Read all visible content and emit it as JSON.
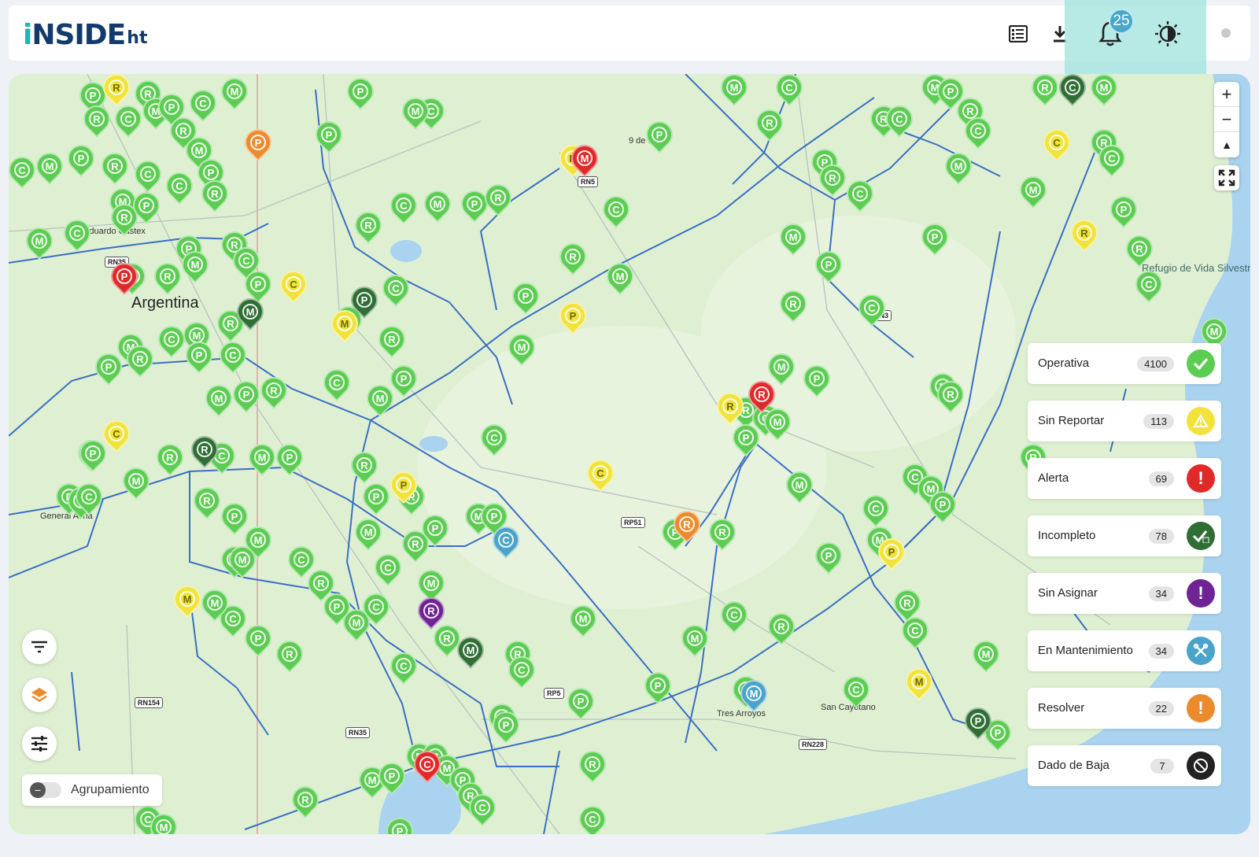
{
  "header": {
    "logo_main": "NSIDE",
    "logo_i": "i",
    "logo_sub": "ht",
    "notifications_count": "25",
    "icons": [
      "table-icon",
      "download-icon",
      "bell-icon",
      "contrast-icon"
    ]
  },
  "map": {
    "places": {
      "argentina": "Argentina",
      "eduardo_castex": "Eduardo Castex",
      "general_acha": "General Acha",
      "nueve_de_julio": "9 de Julio",
      "refugio": "Refugio de Vida Silvestre Bahía de Samborombón",
      "tres_arroyos": "Tres Arroyos",
      "san_cayetano": "San Cayetano"
    },
    "roads": [
      "RN35",
      "RN5",
      "RP51",
      "RN3",
      "RN154",
      "RN35",
      "RN228",
      "RP5"
    ],
    "marker_letters": [
      "P",
      "R",
      "C",
      "M"
    ],
    "colors": {
      "operativa": "#5ccc52",
      "sin_reportar": "#f2e33c",
      "alerta": "#e02a2a",
      "incompleto": "#2f6e34",
      "sin_asignar": "#6f2394",
      "mantenimiento": "#4aa3c8",
      "resolver": "#ec8b2d",
      "baja": "#222222"
    }
  },
  "controls": {
    "zoom_in": "+",
    "zoom_out": "−",
    "compass": "▲",
    "grouping_label": "Agrupamiento"
  },
  "legend": [
    {
      "label": "Operativa",
      "count": "4100",
      "icon": "check-icon",
      "color": "#5ccc52"
    },
    {
      "label": "Sin Reportar",
      "count": "113",
      "icon": "warning-icon",
      "color": "#f2e33c"
    },
    {
      "label": "Alerta",
      "count": "69",
      "icon": "exclamation-icon",
      "color": "#e02a2a"
    },
    {
      "label": "Incompleto",
      "count": "78",
      "icon": "check-doc-icon",
      "color": "#2f6e34"
    },
    {
      "label": "Sin Asignar",
      "count": "34",
      "icon": "exclamation-icon",
      "color": "#6f2394"
    },
    {
      "label": "En Mantenimiento",
      "count": "34",
      "icon": "tools-icon",
      "color": "#4aa3c8"
    },
    {
      "label": "Resolver",
      "count": "22",
      "icon": "exclamation-icon",
      "color": "#ec8b2d"
    },
    {
      "label": "Dado de Baja",
      "count": "7",
      "icon": "blocked-icon",
      "color": "#222222"
    }
  ]
}
